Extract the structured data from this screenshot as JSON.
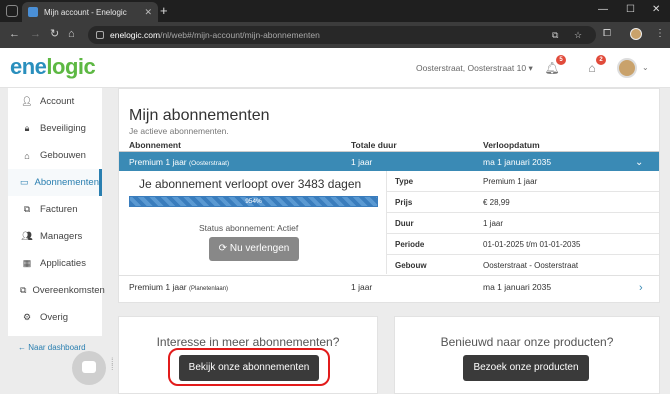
{
  "browser": {
    "tab_title": "Mijn account - Enelogic",
    "url_domain": "enelogic.com",
    "url_path": "/nl/web#/mijn-account/mijn-abonnementen"
  },
  "header": {
    "logo_part1": "ene",
    "logo_part2": "logic",
    "location": "Oosterstraat, Oosterstraat 10",
    "notifications_count": "5",
    "gifts_count": "2"
  },
  "sidebar": {
    "items": [
      {
        "label": "Account",
        "icon": "user-icon"
      },
      {
        "label": "Beveiliging",
        "icon": "lock-icon"
      },
      {
        "label": "Gebouwen",
        "icon": "home-icon"
      },
      {
        "label": "Abonnementen",
        "icon": "card-icon"
      },
      {
        "label": "Facturen",
        "icon": "copy-icon"
      },
      {
        "label": "Managers",
        "icon": "users-icon"
      },
      {
        "label": "Applicaties",
        "icon": "grid-icon"
      },
      {
        "label": "Overeenkomsten",
        "icon": "copy-icon"
      },
      {
        "label": "Overig",
        "icon": "gears-icon"
      }
    ],
    "back_link": "Naar dashboard"
  },
  "main": {
    "title": "Mijn abonnementen",
    "subtitle": "Je actieve abonnementen.",
    "columns": [
      "Abonnement",
      "Totale duur",
      "Verloopdatum"
    ],
    "selected": {
      "name": "Premium 1 jaar",
      "building": "(Oosterstraat)",
      "duration": "1 jaar",
      "expiry": "ma 1 januari 2035"
    },
    "expire_text": "Je abonnement verloopt over 3483 dagen",
    "progress_label": "954%",
    "progress_fraction": 1.0,
    "status_text": "Status abonnement: Actief",
    "renew_label": "Nu verlengen",
    "details": [
      {
        "key": "Type",
        "value": "Premium 1 jaar"
      },
      {
        "key": "Prijs",
        "value": "€ 28,99"
      },
      {
        "key": "Duur",
        "value": "1 jaar"
      },
      {
        "key": "Periode",
        "value": "01-01-2025 t/m 01-01-2035"
      },
      {
        "key": "Gebouw",
        "value": "Oosterstraat - Oosterstraat"
      }
    ],
    "second": {
      "name": "Premium 1 jaar",
      "building": "(Planetenlaan)",
      "duration": "1 jaar",
      "expiry": "ma 1 januari 2035"
    }
  },
  "cards": {
    "left_question": "Interesse in meer abonnementen?",
    "left_button": "Bekijk onze abonnementen",
    "right_question": "Benieuwd naar onze producten?",
    "right_button": "Bezoek onze producten"
  },
  "colors": {
    "accent": "#3a8ab5",
    "highlight": "#e21b1b",
    "logo_blue": "#2a8fbd",
    "logo_green": "#5db843"
  }
}
